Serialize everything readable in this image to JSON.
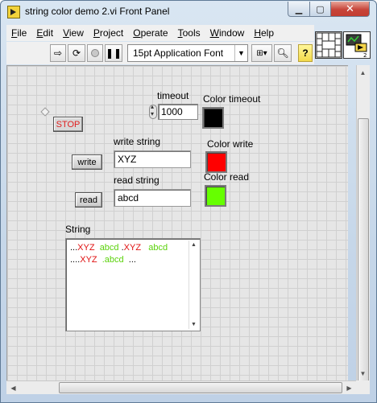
{
  "window": {
    "title": "string color demo 2.vi Front Panel"
  },
  "menu": [
    "File",
    "Edit",
    "View",
    "Project",
    "Operate",
    "Tools",
    "Window",
    "Help"
  ],
  "toolbar": {
    "font_ring": "15pt Application Font",
    "help_label": "?"
  },
  "controls": {
    "stop_label": "STOP",
    "timeout_label": "timeout",
    "timeout_value": "1000",
    "color_timeout_label": "Color timeout",
    "write_string_label": "write string",
    "write_string_value": "XYZ",
    "write_button": "write",
    "color_write_label": "Color write",
    "read_string_label": "read string",
    "read_string_value": "abcd",
    "read_button": "read",
    "color_read_label": "Color read",
    "string_label": "String"
  },
  "colors": {
    "color_timeout": "#000000",
    "color_write": "#ff0000",
    "color_read": "#66ff00",
    "red_text": "#e01010",
    "green_text": "#5ad20a"
  },
  "string_indicator": {
    "lines": [
      [
        {
          "text": "...",
          "color": "black"
        },
        {
          "text": "XYZ",
          "color": "red"
        },
        {
          "text": "  abcd",
          "color": "green"
        },
        {
          "text": " .",
          "color": "black"
        },
        {
          "text": "XYZ",
          "color": "red"
        },
        {
          "text": "   abcd",
          "color": "green"
        }
      ],
      [
        {
          "text": "....",
          "color": "black"
        },
        {
          "text": "XYZ",
          "color": "red"
        },
        {
          "text": "  .abcd",
          "color": "green"
        },
        {
          "text": "  ...",
          "color": "black"
        }
      ]
    ]
  }
}
